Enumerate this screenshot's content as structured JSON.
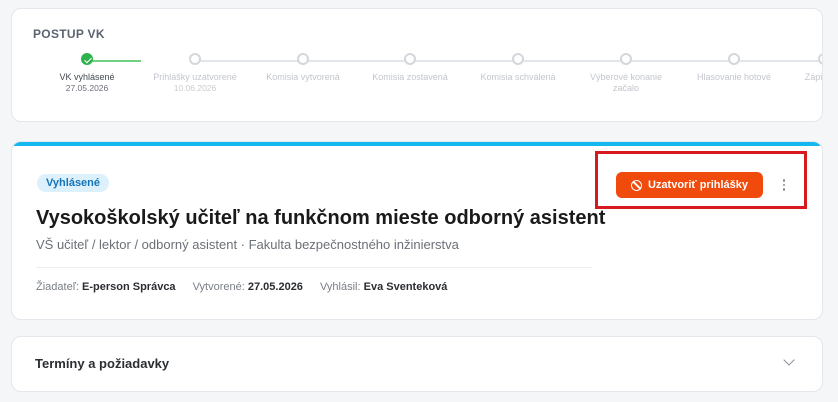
{
  "progress": {
    "title": "POSTUP VK",
    "steps": [
      {
        "label": "VK vyhlásené",
        "date": "27.05.2026",
        "done": true
      },
      {
        "label": "Prihlášky uzatvorené",
        "date": "10.06.2026",
        "done": false
      },
      {
        "label": "Komisia vytvorená",
        "date": "",
        "done": false
      },
      {
        "label": "Komisia zostavená",
        "date": "",
        "done": false
      },
      {
        "label": "Komisia schválená",
        "date": "",
        "done": false
      },
      {
        "label": "Výberové konanie začalo",
        "date": "",
        "done": false
      },
      {
        "label": "Hlasovanie hotové",
        "date": "",
        "done": false
      },
      {
        "label": "Zápisnica",
        "date": "",
        "done": false
      }
    ]
  },
  "detail": {
    "status": "Vyhlásené",
    "title": "Vysokoškolský učiteľ na funkčnom mieste odborný asistent",
    "subtitle": "VŠ učiteľ / lektor / odborný asistent · Fakulta bezpečnostného inžinierstva",
    "meta": {
      "applicant_label": "Žiadateľ:",
      "applicant_value": "E-person Správca",
      "created_label": "Vytvorené:",
      "created_value": "27.05.2026",
      "announced_label": "Vyhlásil:",
      "announced_value": "Eva Sventeková"
    },
    "close_button_label": "Uzatvoriť prihlášky",
    "icons": {
      "close_button": "ban-icon",
      "more": "more-vertical-icon"
    }
  },
  "accordion": {
    "title": "Termíny a požiadavky",
    "icon": "chevron-down-icon"
  },
  "colors": {
    "accent": "#13b8f0",
    "danger_button": "#f04a0c",
    "step_done": "#2fb24c",
    "highlight": "#d71920"
  }
}
